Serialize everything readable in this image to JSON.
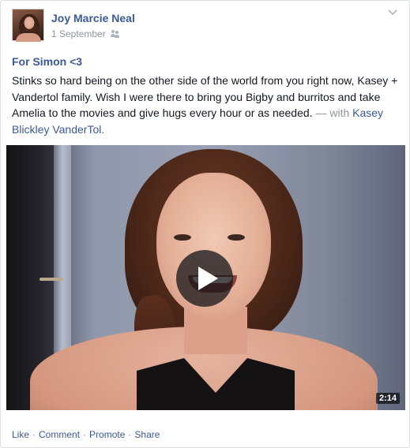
{
  "post": {
    "author": "Joy Marcie Neal",
    "date": "1 September",
    "audience_icon": "friends-icon",
    "title": "For Simon <3",
    "body": "Stinks so hard being on the other side of the world from you right now, Kasey + Vandertol family. Wish I were there to bring you Bigby and burritos and take Amelia to the movies and give hugs every hour or as needed.",
    "with_text": "— with",
    "tagged_person": "Kasey Blickley VanderTol",
    "tagged_suffix": "."
  },
  "video": {
    "duration": "2:14",
    "play_icon": "play-icon"
  },
  "actions": {
    "like": "Like",
    "comment": "Comment",
    "promote": "Promote",
    "share": "Share",
    "separator": "·"
  },
  "colors": {
    "link": "#3b5998",
    "text": "#141823",
    "muted": "#90949c"
  }
}
